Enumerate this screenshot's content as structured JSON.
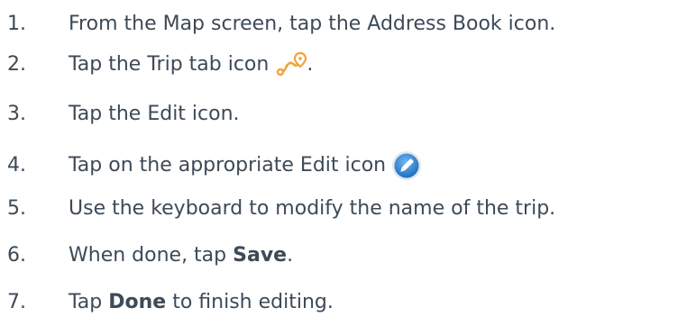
{
  "steps": [
    {
      "num": "1.",
      "text": "From the Map screen, tap the Address Book icon."
    },
    {
      "num": "2.",
      "text": "Tap the Trip tab icon",
      "after": ".",
      "icon": "trip-route-icon",
      "icon_color": "#f2a33a"
    },
    {
      "num": "3.",
      "text": "Tap the Edit icon."
    },
    {
      "num": "4.",
      "text": "Tap on the appropriate Edit icon",
      "icon": "pencil-edit-icon",
      "icon_color": "#2f86d6"
    },
    {
      "num": "5.",
      "text": "Use the keyboard to modify the name of the trip."
    },
    {
      "num": "6.",
      "before": "When done, tap ",
      "bold": "Save",
      "after": "."
    },
    {
      "num": "7.",
      "before": "Tap ",
      "bold": "Done",
      "after": " to finish editing."
    }
  ]
}
